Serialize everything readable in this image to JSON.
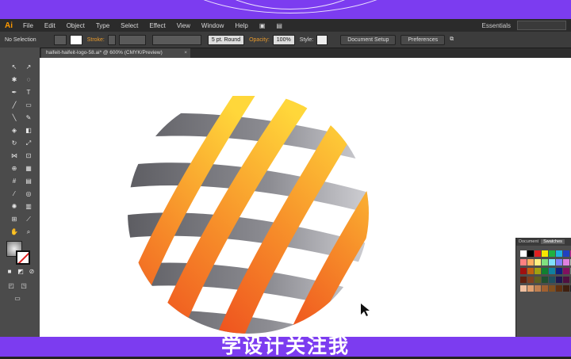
{
  "menubar": {
    "logo": "Ai",
    "items": [
      "File",
      "Edit",
      "Object",
      "Type",
      "Select",
      "Effect",
      "View",
      "Window",
      "Help"
    ],
    "workspace": "Essentials"
  },
  "options_bar": {
    "selection": "No Selection",
    "stroke_label": "Stroke:",
    "brush": "5 pt. Round",
    "opacity_label": "Opacity:",
    "opacity_value": "100%",
    "style_label": "Style:",
    "document_setup": "Document Setup",
    "preferences": "Preferences"
  },
  "document": {
    "tab_title": "haifeit-haifeit-logo-58.ai* @ 600% (CMYK/Preview)"
  },
  "panel": {
    "tabs": [
      "Document",
      "Swatches"
    ],
    "active_tab": "Swatches"
  },
  "colors": {
    "banner": "#7c3cf0",
    "orange_light": "#ffd23a",
    "orange_dark": "#f05a1e",
    "gray_band": "#6e6e73"
  },
  "caption": "学设计关注我"
}
